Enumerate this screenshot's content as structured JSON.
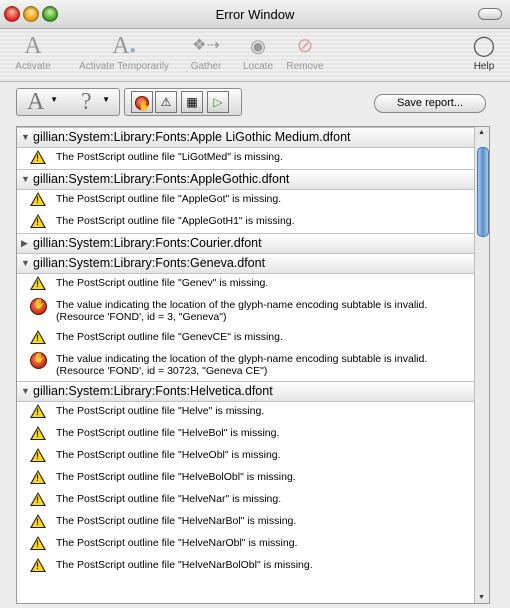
{
  "window": {
    "title": "Error Window"
  },
  "toolbar": {
    "items": [
      {
        "label": "Activate",
        "icon": "font-a-icon"
      },
      {
        "label": "Activate Temporarily",
        "icon": "font-a-clock-icon"
      },
      {
        "label": "Gather",
        "icon": "gather-icon"
      },
      {
        "label": "Locate",
        "icon": "eye-icon"
      },
      {
        "label": "Remove",
        "icon": "remove-icon"
      }
    ],
    "help_label": "Help"
  },
  "filterbar": {
    "save_label": "Save report..."
  },
  "list": {
    "groups": [
      {
        "name": "gillian:System:Library:Fonts:Apple LiGothic Medium.dfont",
        "expanded": true,
        "rows": [
          {
            "type": "warning",
            "msg": "The PostScript outline file \"LiGotMed\" is missing."
          }
        ]
      },
      {
        "name": "gillian:System:Library:Fonts:AppleGothic.dfont",
        "expanded": true,
        "rows": [
          {
            "type": "warning",
            "msg": "The PostScript outline file \"AppleGot\" is missing."
          },
          {
            "type": "warning",
            "msg": "The PostScript outline file \"AppleGotH1\" is missing."
          }
        ]
      },
      {
        "name": "gillian:System:Library:Fonts:Courier.dfont",
        "expanded": false,
        "rows": []
      },
      {
        "name": "gillian:System:Library:Fonts:Geneva.dfont",
        "expanded": true,
        "rows": [
          {
            "type": "warning",
            "msg": "The PostScript outline file \"Genev\" is missing."
          },
          {
            "type": "error",
            "msg": "The value indicating the location of the glyph-name encoding subtable is invalid. (Resource 'FOND', id = 3, \"Geneva\")"
          },
          {
            "type": "warning",
            "msg": "The PostScript outline file \"GenevCE\" is missing."
          },
          {
            "type": "error",
            "msg": "The value indicating the location of the glyph-name encoding subtable is invalid. (Resource 'FOND', id = 30723, \"Geneva CE\")"
          }
        ]
      },
      {
        "name": "gillian:System:Library:Fonts:Helvetica.dfont",
        "expanded": true,
        "rows": [
          {
            "type": "warning",
            "msg": "The PostScript outline file \"Helve\" is missing."
          },
          {
            "type": "warning",
            "msg": "The PostScript outline file \"HelveBol\" is missing."
          },
          {
            "type": "warning",
            "msg": "The PostScript outline file \"HelveObl\" is missing."
          },
          {
            "type": "warning",
            "msg": "The PostScript outline file \"HelveBolObl\" is missing."
          },
          {
            "type": "warning",
            "msg": "The PostScript outline file \"HelveNar\" is missing."
          },
          {
            "type": "warning",
            "msg": "The PostScript outline file \"HelveNarBol\" is missing."
          },
          {
            "type": "warning",
            "msg": "The PostScript outline file \"HelveNarObl\" is missing."
          },
          {
            "type": "warning",
            "msg": "The PostScript outline file \"HelveNarBolObl\" is missing."
          }
        ]
      }
    ]
  }
}
